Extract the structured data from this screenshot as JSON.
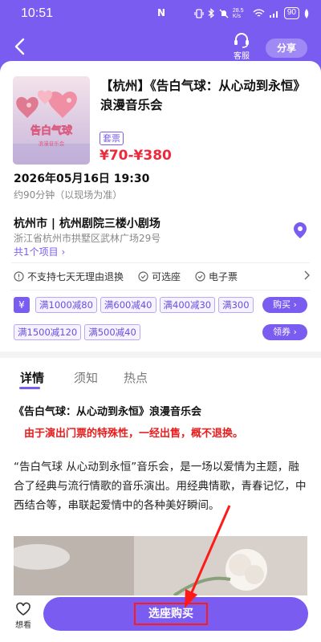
{
  "status_bar": {
    "time": "10:51",
    "nfc": "N",
    "net_speed": "28.5 K/s",
    "battery": "90"
  },
  "header": {
    "service_label": "客服",
    "share_label": "分享"
  },
  "show": {
    "title": "【杭州】《告白气球：从心动到永恒》浪漫音乐会",
    "tag": "套票",
    "price": "¥70-¥380",
    "date": "2026年05月16日 19:30",
    "duration": "约90分钟（以现场为准）",
    "venue": "杭州市 | 杭州剧院三楼小剧场",
    "address": "浙江省杭州市拱墅区武林广场29号",
    "projects": "共1个项目"
  },
  "poster": {
    "title_text": "告白气球",
    "sub_text": "浪漫音乐会"
  },
  "features": [
    "不支持七天无理由退换",
    "可选座",
    "电子票"
  ],
  "coupons": {
    "row1": [
      "满1000减80",
      "满600减40",
      "满400减30",
      "满300"
    ],
    "row1_button": "购买",
    "row2": [
      "满1500减120",
      "满500减40"
    ],
    "row2_button": "领券"
  },
  "tabs": [
    "详情",
    "须知",
    "热点"
  ],
  "detail": {
    "title": "《告白气球：从心动到永恒》浪漫音乐会",
    "notice": "由于演出门票的特殊性，一经出售，概不退换。",
    "paragraph": "“告白气球 从心动到永恒”音乐会，是一场以爱情为主题，融合了经典与流行情歌的音乐演出。用经典情歌，青春记忆，中西结合等，串联起爱情中的各种美好瞬间。"
  },
  "bottom": {
    "fav_label": "想看",
    "buy_label": "选座购买"
  },
  "colors": {
    "accent": "#7b5cf0",
    "price": "#f0283c",
    "notice": "#e81c1c",
    "annotation": "#ff1a1a"
  },
  "icons": [
    "back-arrow-icon",
    "headset-icon",
    "location-pin-icon",
    "circle-info-icon",
    "circle-check-icon",
    "chevron-right-icon",
    "yen-icon",
    "heart-icon"
  ]
}
